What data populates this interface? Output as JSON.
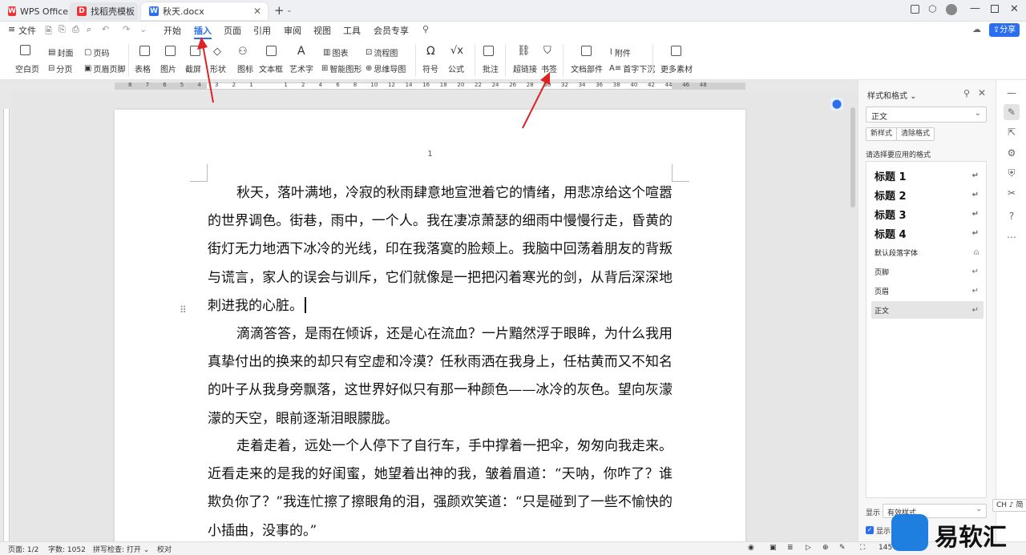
{
  "tabs": [
    {
      "label": "WPS Office",
      "icon": "wps-logo-icon",
      "color": "#e33"
    },
    {
      "label": "找稻壳模板",
      "icon": "docer-icon",
      "color": "#e33"
    },
    {
      "label": "秋天.docx",
      "icon": "word-doc-icon",
      "color": "#2b6ff0"
    }
  ],
  "new_tab": "+",
  "menu": {
    "file": "文件",
    "items": [
      "开始",
      "插入",
      "页面",
      "引用",
      "审阅",
      "视图",
      "工具",
      "会员专享"
    ],
    "active": "插入",
    "share": "分享"
  },
  "ribbon": {
    "blank_page": "空白页",
    "cover": "封面",
    "page_break": "分页",
    "page_number": "页码",
    "header_footer": "页眉页脚",
    "table": "表格",
    "picture": "图片",
    "screenshot": "截屏",
    "shape": "形状",
    "icon": "图标",
    "textbox": "文本框",
    "wordart": "艺术字",
    "chart": "图表",
    "smart_shape": "智能图形",
    "flowchart": "流程图",
    "mindmap": "思维导图",
    "symbol": "符号",
    "formula": "公式",
    "comment": "批注",
    "hyperlink": "超链接",
    "bookmark": "书签",
    "doc_parts": "文档部件",
    "attachment": "附件",
    "drop_cap": "首字下沉",
    "more": "更多素材"
  },
  "ruler_ticks": [
    "8",
    "7",
    "6",
    "5",
    "4",
    "3",
    "2",
    "1",
    "",
    "1",
    "2",
    "4",
    "6",
    "8",
    "10",
    "12",
    "14",
    "16",
    "18",
    "20",
    "22",
    "24",
    "26",
    "28",
    "30",
    "32",
    "34",
    "36",
    "38",
    "40",
    "42",
    "44",
    "46",
    "48"
  ],
  "document": {
    "page_number": "1",
    "paragraphs": [
      "秋天，落叶满地，冷寂的秋雨肆意地宣泄着它的情绪，用悲凉给这个喧嚣的世界调色。街巷，雨中，一个人。我在凄凉萧瑟的细雨中慢慢行走，昏黄的街灯无力地洒下冰冷的光线，印在我落寞的脸颊上。我脑中回荡着朋友的背叛与谎言，家人的误会与训斥，它们就像是一把把闪着寒光的剑，从背后深深地刺进我的心脏。",
      "滴滴答答，是雨在倾诉，还是心在流血？一片黯然浮于眼眸，为什么我用真挚付出的换来的却只有空虚和冷漠？任秋雨洒在我身上，任枯黄而又不知名的叶子从我身旁飘落，这世界好似只有那一种颜色——冰冷的灰色。望向灰濛濛的天空，眼前逐渐泪眼朦胧。",
      "走着走着，远处一个人停下了自行车，手中撑着一把伞，匆匆向我走来。近看走来的是我的好闺蜜，她望着出神的我，皱着眉道：“天呐，你咋了？谁欺负你了？”我连忙擦了擦眼角的泪，强颜欢笑道：“只是碰到了一些不愉快的小插曲，没事的。”"
    ]
  },
  "panel": {
    "title": "样式和格式",
    "current_style": "正文",
    "new_style": "新样式",
    "clear_format": "清除格式",
    "prompt": "请选择要应用的格式",
    "styles": [
      {
        "name": "标题 1",
        "kind": "h"
      },
      {
        "name": "标题 2",
        "kind": "h"
      },
      {
        "name": "标题 3",
        "kind": "h"
      },
      {
        "name": "标题 4",
        "kind": "h"
      },
      {
        "name": "默认段落字体",
        "kind": "n"
      },
      {
        "name": "页脚",
        "kind": "n"
      },
      {
        "name": "页眉",
        "kind": "n"
      },
      {
        "name": "正文",
        "kind": "n",
        "active": true
      }
    ],
    "show_label": "显示",
    "show_value": "有效样式",
    "show_check": "显示"
  },
  "status": {
    "page": "页面: 1/2",
    "words": "字数: 1052",
    "spell": "拼写检查: 打开",
    "proof": "校对",
    "zoom": "145"
  },
  "ime": "CH ♪ 简",
  "watermark": "易软汇"
}
